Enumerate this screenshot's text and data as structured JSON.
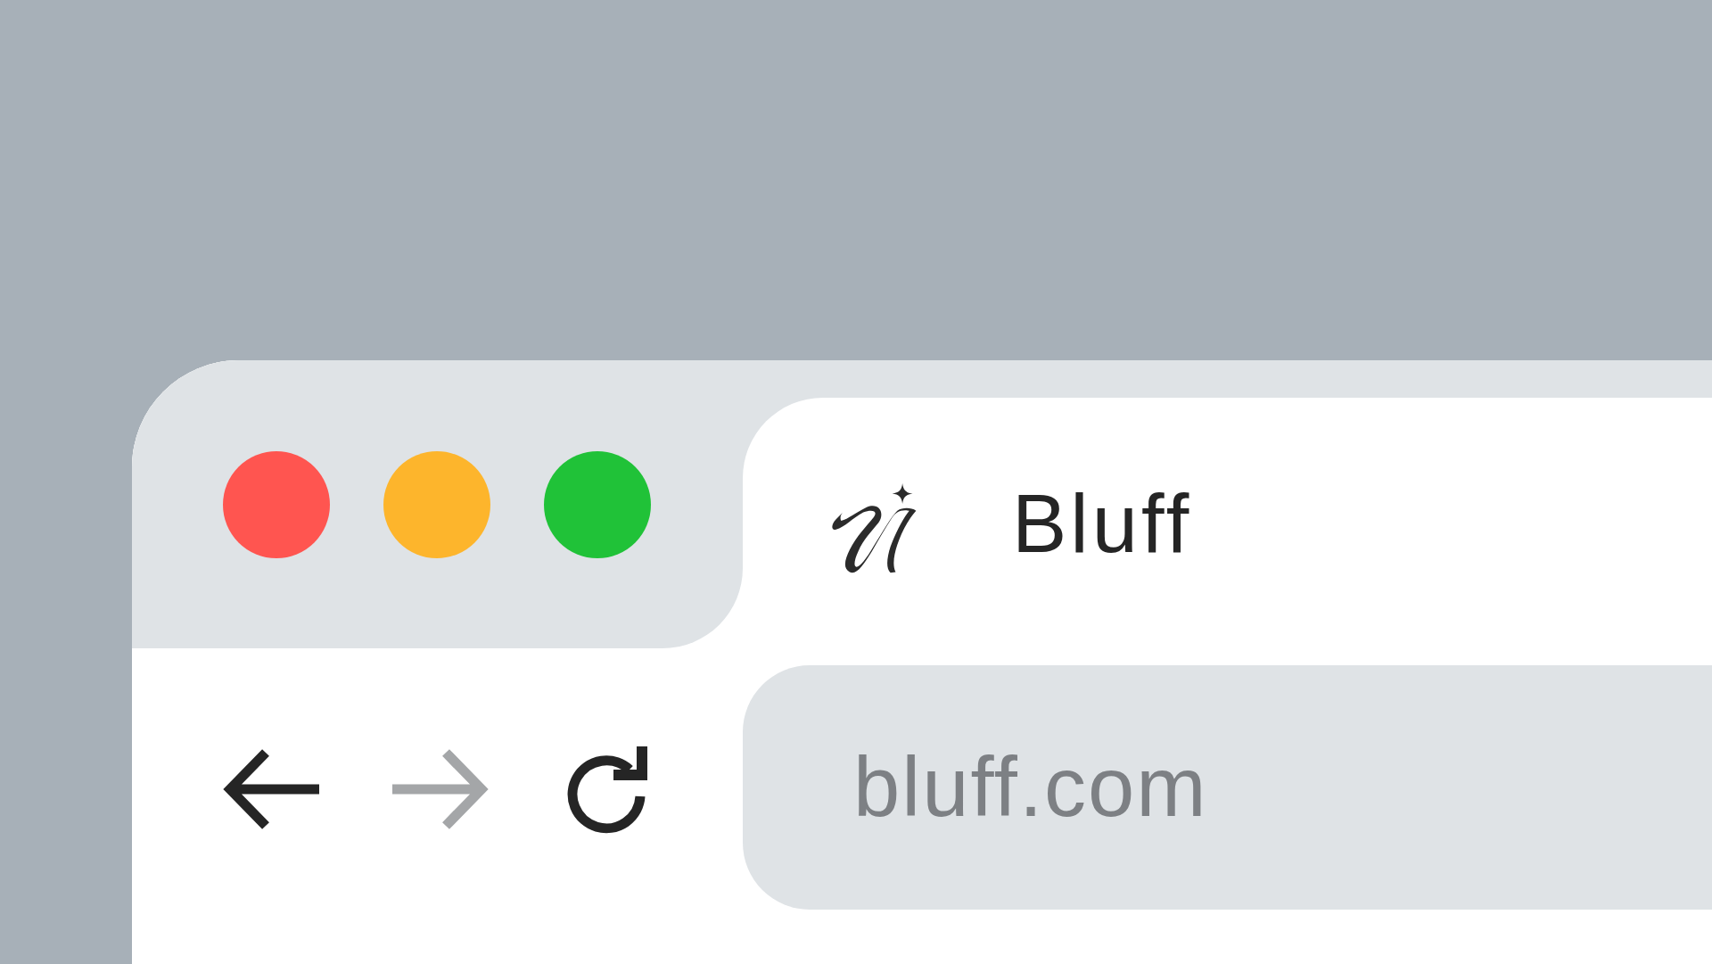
{
  "window_controls": [
    {
      "color": "#ff5550"
    },
    {
      "color": "#fdb52c"
    },
    {
      "color": "#20c238"
    }
  ],
  "tab": {
    "title": "Bluff",
    "selected": true
  },
  "toolbar": {
    "buttons": [
      {
        "kind": "back",
        "disabled": false
      },
      {
        "kind": "forward",
        "disabled": true
      },
      {
        "kind": "reload",
        "disabled": false
      }
    ]
  },
  "address_bar": {
    "value": "bluff.com"
  }
}
